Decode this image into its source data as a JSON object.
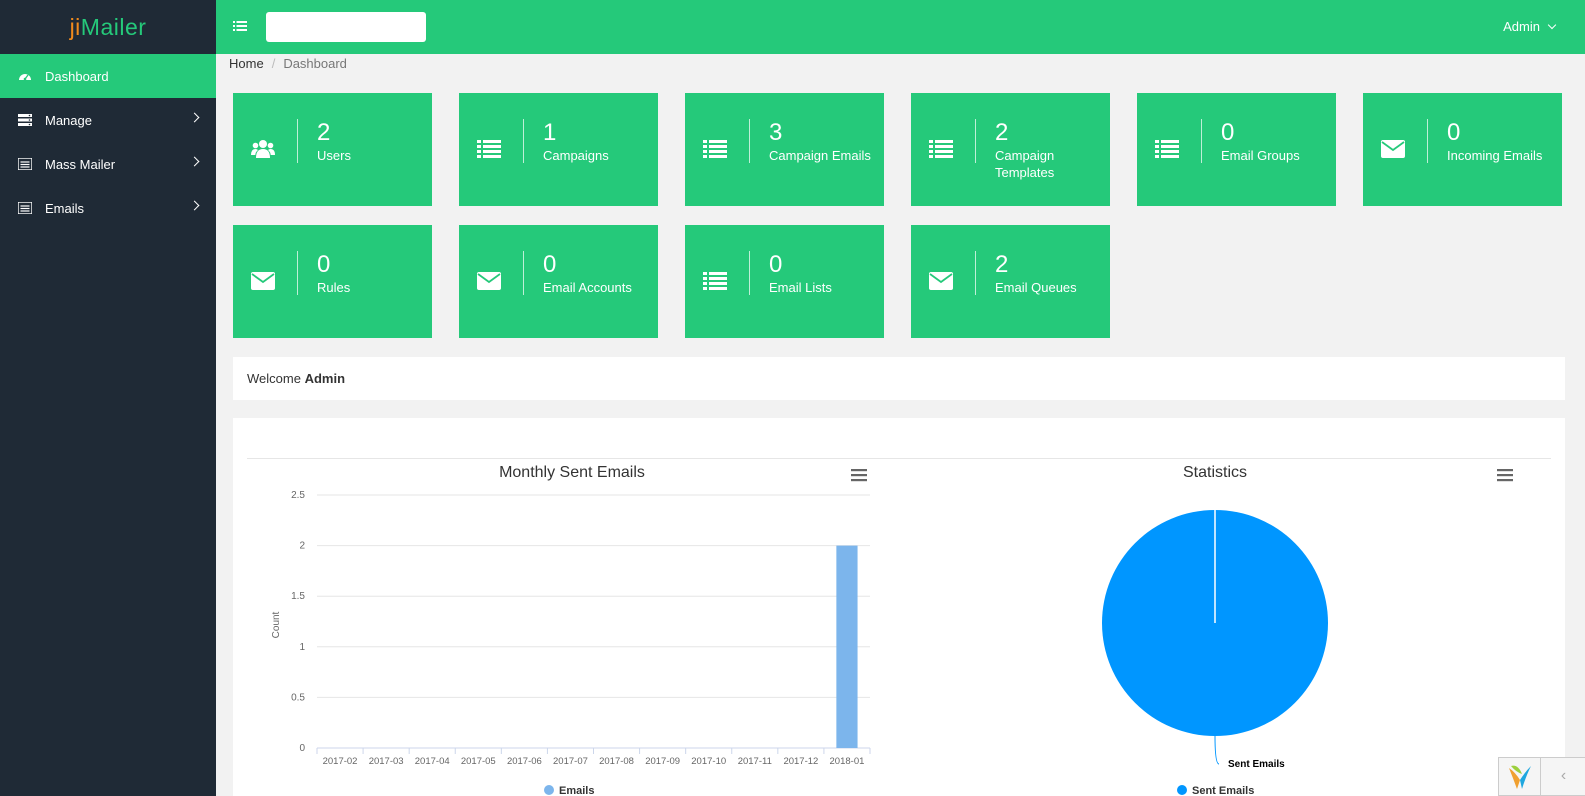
{
  "brand": {
    "part1": "ji",
    "part2": "Mailer"
  },
  "sidebar": {
    "items": [
      {
        "label": "Dashboard",
        "icon": "dashboard-icon",
        "active": true
      },
      {
        "label": "Manage",
        "icon": "server-icon"
      },
      {
        "label": "Mass Mailer",
        "icon": "list-icon"
      },
      {
        "label": "Emails",
        "icon": "list-icon"
      }
    ]
  },
  "header": {
    "search_value": "",
    "user": "Admin"
  },
  "breadcrumb": {
    "home": "Home",
    "separator": "/",
    "current": "Dashboard"
  },
  "cards": [
    {
      "value": "2",
      "label": "Users",
      "icon": "users-icon"
    },
    {
      "value": "1",
      "label": "Campaigns",
      "icon": "list-icon"
    },
    {
      "value": "3",
      "label": "Campaign Emails",
      "icon": "list-icon"
    },
    {
      "value": "2",
      "label": "Campaign Templates",
      "icon": "list-icon"
    },
    {
      "value": "0",
      "label": "Email Groups",
      "icon": "list-icon"
    },
    {
      "value": "0",
      "label": "Incoming Emails",
      "icon": "envelope-icon"
    },
    {
      "value": "0",
      "label": "Rules",
      "icon": "envelope-icon"
    },
    {
      "value": "0",
      "label": "Email Accounts",
      "icon": "envelope-icon"
    },
    {
      "value": "0",
      "label": "Email Lists",
      "icon": "list-icon"
    },
    {
      "value": "2",
      "label": "Email Queues",
      "icon": "envelope-icon"
    }
  ],
  "welcome": {
    "prefix": "Welcome",
    "name": "Admin"
  },
  "colors": {
    "primary": "#25c97a",
    "sidebar": "#1f2a36",
    "bar": "#7cb5ec",
    "pie": "#0096ff",
    "logo_orange": "#f08a1c"
  },
  "chart_data": [
    {
      "type": "bar",
      "title": "Monthly Sent Emails",
      "xlabel": "",
      "ylabel": "Count",
      "categories": [
        "2017-02",
        "2017-03",
        "2017-04",
        "2017-05",
        "2017-06",
        "2017-07",
        "2017-08",
        "2017-09",
        "2017-10",
        "2017-11",
        "2017-12",
        "2018-01"
      ],
      "series": [
        {
          "name": "Emails",
          "values": [
            0,
            0,
            0,
            0,
            0,
            0,
            0,
            0,
            0,
            0,
            0,
            2
          ]
        }
      ],
      "ylim": [
        0,
        2.5
      ],
      "yticks": [
        "0",
        "0.5",
        "1",
        "1.5",
        "2",
        "2.5"
      ],
      "grid": true,
      "legend": "bottom"
    },
    {
      "type": "pie",
      "title": "Statistics",
      "slices": [
        {
          "name": "Sent Emails",
          "value": 100
        }
      ],
      "legend": "bottom"
    }
  ]
}
